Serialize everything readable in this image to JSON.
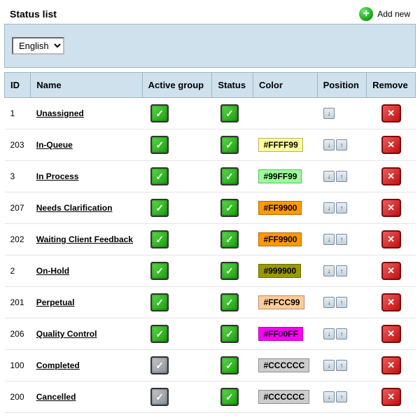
{
  "title": "Status list",
  "add_new_label": "Add new",
  "language_selected": "English",
  "columns": {
    "id": "ID",
    "name": "Name",
    "active_group": "Active group",
    "status": "Status",
    "color": "Color",
    "position": "Position",
    "remove": "Remove"
  },
  "rows": [
    {
      "id": "1",
      "name": "Unassigned",
      "active": true,
      "status": true,
      "color": "",
      "pos_down": true,
      "pos_up": false
    },
    {
      "id": "203",
      "name": "In-Queue",
      "active": true,
      "status": true,
      "color": "#FFFF99",
      "pos_down": true,
      "pos_up": true
    },
    {
      "id": "3",
      "name": "In Process",
      "active": true,
      "status": true,
      "color": "#99FF99",
      "pos_down": true,
      "pos_up": true
    },
    {
      "id": "207",
      "name": "Needs Clarification",
      "active": true,
      "status": true,
      "color": "#FF9900",
      "pos_down": true,
      "pos_up": true
    },
    {
      "id": "202",
      "name": "Waiting Client Feedback",
      "active": true,
      "status": true,
      "color": "#FF9900",
      "pos_down": true,
      "pos_up": true
    },
    {
      "id": "2",
      "name": "On-Hold",
      "active": true,
      "status": true,
      "color": "#999900",
      "pos_down": true,
      "pos_up": true
    },
    {
      "id": "201",
      "name": "Perpetual",
      "active": true,
      "status": true,
      "color": "#FFCC99",
      "pos_down": true,
      "pos_up": true
    },
    {
      "id": "206",
      "name": "Quality Control",
      "active": true,
      "status": true,
      "color": "#FF00FF",
      "pos_down": true,
      "pos_up": true
    },
    {
      "id": "100",
      "name": "Completed",
      "active": false,
      "status": true,
      "color": "#CCCCCC",
      "pos_down": true,
      "pos_up": true
    },
    {
      "id": "200",
      "name": "Cancelled",
      "active": false,
      "status": true,
      "color": "#CCCCCC",
      "pos_down": true,
      "pos_up": true
    }
  ]
}
